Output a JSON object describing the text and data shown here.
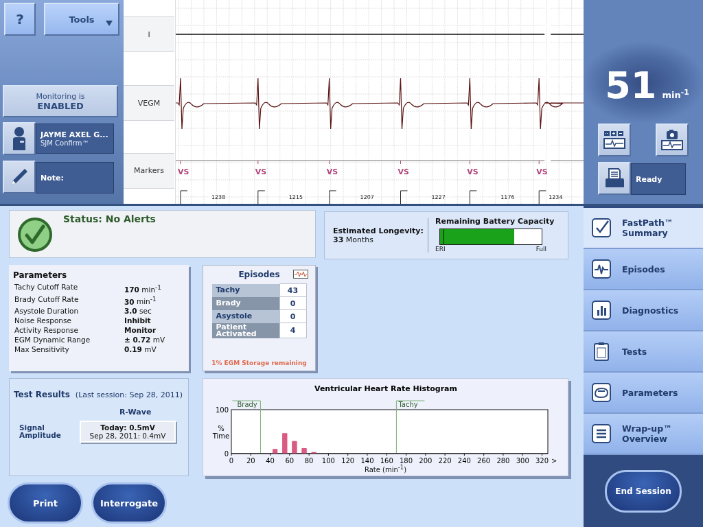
{
  "toolbar": {
    "help_button": "?",
    "tools_button": "Tools"
  },
  "monitoring": {
    "line1": "Monitoring is",
    "line2": "ENABLED"
  },
  "patient": {
    "name": "JAYME AXEL G...",
    "device": "SJM Confirm™"
  },
  "note": {
    "label": "Note:"
  },
  "strip": {
    "channels": [
      {
        "label": "I",
        "kind": "flat"
      },
      {
        "label": "VEGM",
        "kind": "egm"
      },
      {
        "label": "Markers",
        "kind": "markers"
      }
    ],
    "markers": [
      {
        "label": "VS",
        "interval": "1238"
      },
      {
        "label": "VS",
        "interval": "1215"
      },
      {
        "label": "VS",
        "interval": "1207"
      },
      {
        "label": "VS",
        "interval": "1227"
      },
      {
        "label": "VS",
        "interval": "1176"
      },
      {
        "label": "VS",
        "interval": "1234"
      }
    ]
  },
  "heart_rate": {
    "value": "51",
    "unit": "min$^{-1}$"
  },
  "printer": {
    "status": "Ready"
  },
  "status": {
    "text": "Status: No Alerts"
  },
  "longevity": {
    "label": "Estimated Longevity:",
    "value": "**33** Months"
  },
  "battery": {
    "title": "Remaining Battery Capacity",
    "level": 0.73,
    "low_label": "ERI",
    "high_label": "Full"
  },
  "parameters": {
    "title": "Parameters",
    "rows": [
      {
        "label": "Tachy Cutoff Rate",
        "value": "170",
        "unit": "min$^{-1}$"
      },
      {
        "label": "Brady Cutoff Rate",
        "value": "30",
        "unit": "min$^{-1}$"
      },
      {
        "label": "Asystole Duration",
        "value": "3.0",
        "unit": "sec"
      },
      {
        "label": "Noise Response",
        "value": "Inhibit"
      },
      {
        "label": "Activity Response",
        "value": "Monitor"
      },
      {
        "label": "EGM Dynamic Range",
        "value": "± 0.72",
        "unit": "mV"
      },
      {
        "label": "Max Sensitivity",
        "value": "0.19",
        "unit": "mV"
      }
    ]
  },
  "episodes": {
    "title": "Episodes",
    "rows": [
      {
        "label": "Tachy",
        "count": "43"
      },
      {
        "label": "Brady",
        "count": "0"
      },
      {
        "label": "Asystole",
        "count": "0"
      },
      {
        "label": "Patient Activated",
        "count": "4"
      }
    ],
    "storage_note": "1% EGM Storage remaining"
  },
  "test_results": {
    "title": "Test Results",
    "session": "(Last session: Sep 28, 2011)",
    "column": "R-Wave",
    "row_label": "Signal Amplitude",
    "today": "Today: 0.5mV",
    "previous": "Sep 28, 2011: 0.4mV"
  },
  "histogram": {
    "overflow_label": ">",
    "chart_data": {
      "type": "bar",
      "title": "Ventricular Heart Rate Histogram",
      "xlabel": "Rate (min$^{-1}$)",
      "ylabel": "% Time",
      "x": [
        45,
        55,
        65,
        75,
        85
      ],
      "values": [
        9,
        45,
        27,
        11,
        2
      ],
      "xlim": [
        0,
        326
      ],
      "ylim": [
        0,
        100
      ],
      "xticks": [
        0,
        20,
        40,
        60,
        80,
        100,
        120,
        140,
        160,
        180,
        200,
        220,
        240,
        260,
        280,
        300,
        320
      ],
      "yticks": [
        0,
        100
      ],
      "ref_lines": [
        {
          "axis": "x",
          "value": 30,
          "label": "Brady"
        },
        {
          "axis": "x",
          "value": 170,
          "label": "Tachy"
        }
      ]
    }
  },
  "nav": [
    {
      "label": "FastPath™ Summary",
      "selected": true
    },
    {
      "label": "Episodes",
      "selected": false
    },
    {
      "label": "Diagnostics",
      "selected": false
    },
    {
      "label": "Tests",
      "selected": false
    },
    {
      "label": "Parameters",
      "selected": false
    },
    {
      "label": "Wrap-up™ Overview",
      "selected": false
    }
  ],
  "actions": {
    "print": "Print",
    "interrogate": "Interrogate",
    "end_session": "End Session"
  }
}
